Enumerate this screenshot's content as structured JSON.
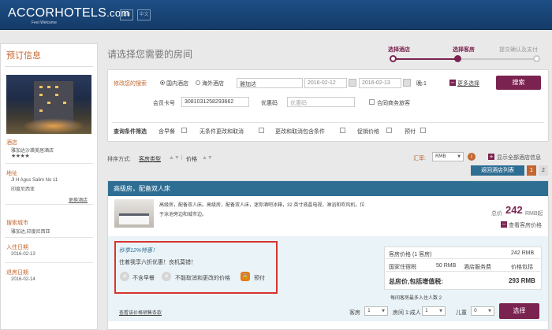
{
  "header": {
    "logo_main": "ACCORHOTELS",
    "logo_domain": ".com",
    "tagline": "Feel Welcome",
    "lang_en": "EN",
    "lang_cn": "中文"
  },
  "sidebar": {
    "title": "预订信息",
    "hotel_label": "酒店",
    "hotel_name": "雅加达沙璜美居酒店",
    "stars": "★★★★",
    "address_label": "地址",
    "address_line1": "Jl H Agus Salim No 11",
    "address_line2": "印度尼西亚",
    "change_hotel": "更换酒店",
    "city_label": "搜索城市",
    "city_value": "雅加达,印度尼西亚",
    "checkin_label": "入住日期",
    "checkin_value": "2016-02-13",
    "checkout_label": "退房日期",
    "checkout_value": "2016-02-14"
  },
  "main": {
    "title": "请选择您需要的房间"
  },
  "steps": [
    {
      "label": "选择酒店"
    },
    {
      "label": "选择客房"
    },
    {
      "label": "提交确认及支付"
    }
  ],
  "search": {
    "modify_label": "修改您的搜索",
    "domestic": "国内酒店",
    "overseas": "海外酒店",
    "destination": "雅加达",
    "date_from": "2016-02-12",
    "date_to": "2016-02-13",
    "nights": "晚:1",
    "more_options": "更多选择",
    "search_button": "搜索",
    "member_label": "会员卡号",
    "member_value": "3081031258293662",
    "promo_label": "优惠码",
    "promo_placeholder": "优惠码",
    "corporate": "合同商务旅客",
    "filter_label": "查询条件筛选",
    "filters": [
      "含早餐",
      "无条件更改和取消",
      "更改和取消包含条件",
      "促销价格",
      "预付"
    ]
  },
  "sort": {
    "label": "排序方式:",
    "room_type": "客房类型",
    "price": "价格",
    "rate_label": "汇率:",
    "currency": "RMB",
    "show_all": "显示全部酒店信息",
    "back_to_list": "返回酒店列表",
    "page1": "1",
    "page2": "2"
  },
  "room": {
    "name": "高级房，配备双人床",
    "description_line1": "高级房，配备双人床。高级房，配备双人床，迷你酒吧冰箱，32 英寸液晶电视，淋浴和吹风机，位",
    "description_line2": "于泳池旁边和城市边。",
    "total_label": "总价",
    "total_price": "242",
    "total_unit": "RMB起",
    "view_rates": "查看客房价格",
    "promo_title": "秒享12%特惠！",
    "promo_sub": "住着我享六折优惠！良机莫错！",
    "feature1": "不含早餐",
    "feature2": "不能取消和更改的价格",
    "feature3": "预付",
    "price_rows": [
      {
        "label": "客房价格 (1 客房)",
        "value": "242 RMB"
      },
      {
        "label": "国家住宿税",
        "value": "50 RMB",
        "label2": "酒店服务费",
        "value2": "价格包括"
      }
    ],
    "total_incl_label": "总房价,包括增值税:",
    "total_incl_value": "293 RMB",
    "max_occupancy": "每间客房最多入住人数 2",
    "view_terms": "查看该价格销售条款",
    "rooms_label": "客房",
    "rooms_value": "1",
    "room_adults_label": "房间 1:成人",
    "adults_value": "1",
    "children_label": "儿童",
    "children_value": "0",
    "select_button": "选择"
  },
  "colors": {
    "brand_blue": "#1d4f86",
    "accent_purple": "#7b2350",
    "accent_orange": "#c3662f",
    "room_header": "#2f6e93",
    "promo_border": "#d9332e"
  }
}
